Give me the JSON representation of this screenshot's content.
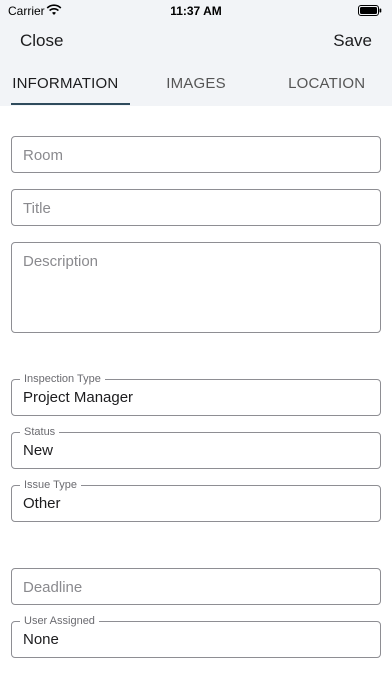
{
  "status_bar": {
    "carrier": "Carrier",
    "time": "11:37 AM"
  },
  "nav": {
    "close_label": "Close",
    "save_label": "Save"
  },
  "tabs": [
    {
      "label": "INFORMATION",
      "active": true
    },
    {
      "label": "IMAGES",
      "active": false
    },
    {
      "label": "LOCATION",
      "active": false
    }
  ],
  "form": {
    "room": {
      "placeholder": "Room",
      "value": ""
    },
    "title": {
      "placeholder": "Title",
      "value": ""
    },
    "description": {
      "placeholder": "Description",
      "value": ""
    },
    "inspection_type": {
      "label": "Inspection Type",
      "value": "Project Manager"
    },
    "status": {
      "label": "Status",
      "value": "New"
    },
    "issue_type": {
      "label": "Issue Type",
      "value": "Other"
    },
    "deadline": {
      "placeholder": "Deadline",
      "value": ""
    },
    "user_assigned": {
      "label": "User Assigned",
      "value": "None"
    }
  },
  "colors": {
    "accent": "#2f4b5c",
    "header_bg": "#f2f4f7",
    "border": "#8e8e93"
  }
}
